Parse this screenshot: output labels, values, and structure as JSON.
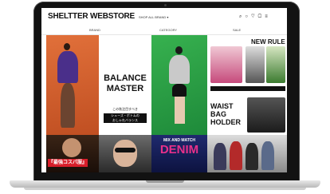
{
  "store": {
    "brand": "SHELTTER WEBSTORE",
    "selector": "SHOP ALL BRAND ▾",
    "header_icons": [
      "search-icon",
      "account-icon",
      "favorite-icon",
      "cart-icon",
      "menu-icon"
    ],
    "nav": [
      "BRAND",
      "CATEGORY",
      "SALE"
    ]
  },
  "banners": {
    "balance": {
      "title_line1": "BALANCE",
      "title_line2": "MASTER",
      "copy": "この秋注目すべき",
      "box_line1": "シューズ・ボトムの",
      "box_line2": "おしゃれバランス"
    },
    "new_rule": {
      "title": "NEW RULE"
    },
    "waist": {
      "line1": "WAIST",
      "line2": "BAG",
      "line3": "HOLDER"
    },
    "denim": {
      "mix": "MIX AND MATCH",
      "title": "DENIM"
    },
    "kosupa": {
      "label": "『最強コスパ服』"
    }
  },
  "colors": {
    "accent_pink": "#e8308a",
    "accent_red": "#d81e2a"
  }
}
